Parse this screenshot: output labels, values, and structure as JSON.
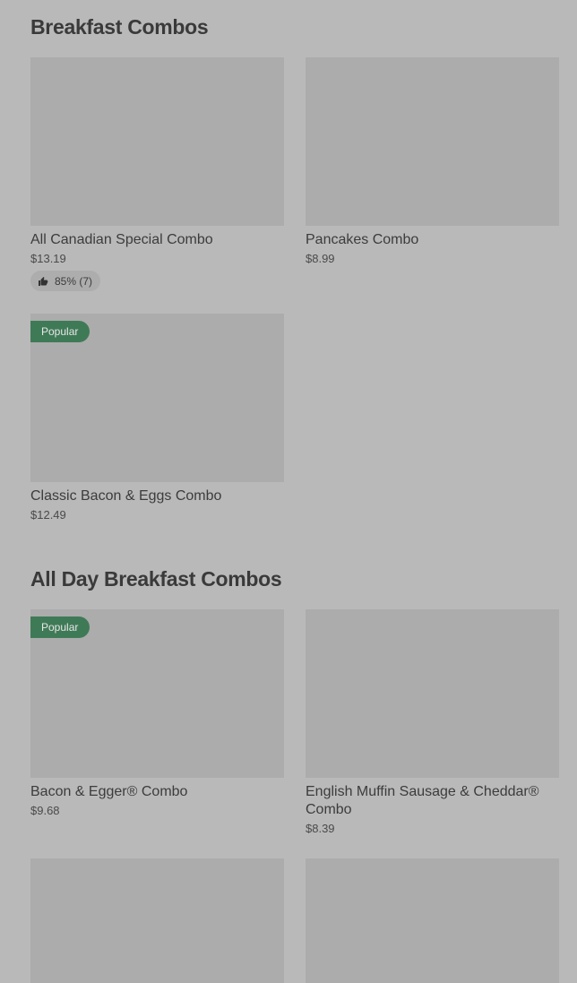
{
  "sections": [
    {
      "title": "Breakfast Combos",
      "items": [
        {
          "name": "All Canadian Special Combo",
          "price": "$13.19",
          "rating": "85% (7)"
        },
        {
          "name": "Pancakes Combo",
          "price": "$8.99"
        },
        {
          "name": "Classic Bacon & Eggs Combo",
          "price": "$12.49",
          "badge": "Popular"
        }
      ]
    },
    {
      "title": "All Day Breakfast Combos",
      "items": [
        {
          "name": "Bacon & Egger® Combo",
          "price": "$9.68",
          "badge": "Popular"
        },
        {
          "name": "English Muffin Sausage & Cheddar® Combo",
          "price": "$8.39"
        }
      ]
    }
  ],
  "colors": {
    "page_background": "#b9b9b9",
    "image_placeholder": "#acacac",
    "popular_badge": "#3f7a57",
    "rating_pill": "#adadad"
  },
  "icons": {
    "rating": "thumbs-up-icon"
  }
}
